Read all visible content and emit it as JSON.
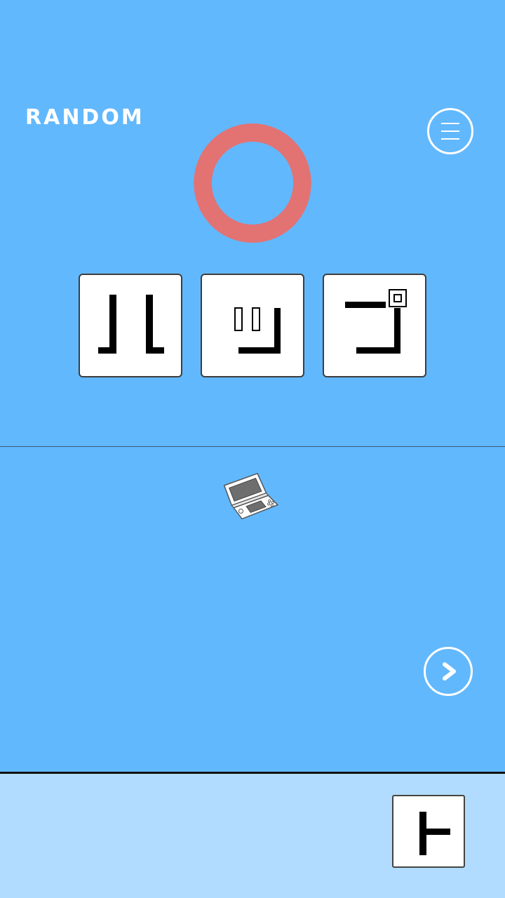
{
  "header": {
    "title": "RANDOM"
  },
  "icons": {
    "menu": "hamburger-menu-icon",
    "feedback": "correct-circle-icon",
    "item": "handheld-console-icon",
    "next": "chevron-right-icon"
  },
  "puzzle": {
    "tiles": [
      {
        "glyph": "ル"
      },
      {
        "glyph": "ッ"
      },
      {
        "glyph": "プ"
      }
    ]
  },
  "inventory": {
    "items": [
      {
        "glyph": "ト"
      }
    ]
  },
  "colors": {
    "background": "#62b8fd",
    "correct_ring": "#e37273",
    "inventory_bar": "#b1dcff"
  }
}
